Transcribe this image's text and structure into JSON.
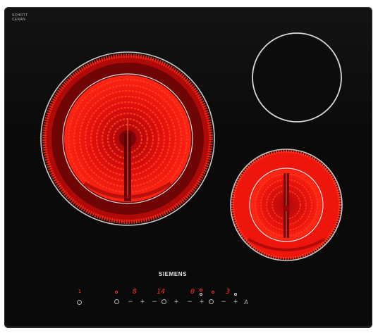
{
  "brand": {
    "name": "SIEMENS"
  },
  "glass_logo": {
    "line1": "SCHOTT",
    "line2": "CERAN",
    "line3": ""
  },
  "zones": {
    "large_zone": {
      "state": "on",
      "color": "#ff1a0a"
    },
    "top_right_zone": {
      "state": "off",
      "color": "#d8d8d8"
    },
    "bottom_right_zone": {
      "state": "on",
      "color": "#ff1a0a"
    }
  },
  "control_panel": {
    "power_icon": "power-icon",
    "zone1": {
      "display": "8",
      "minus": "−",
      "plus": "+"
    },
    "timer": {
      "display": "14",
      "minus": "−",
      "plus": "+"
    },
    "zone2": {
      "display": "0",
      "minus": "−",
      "plus": "+"
    },
    "zone3": {
      "display": "3",
      "minus": "−",
      "plus": "+"
    },
    "lock_symbol": "A",
    "indicator_1": "1"
  },
  "colors": {
    "glass": "#0a0a0b",
    "glow": "#ff1a0a",
    "controls": "#b8b8b8"
  }
}
